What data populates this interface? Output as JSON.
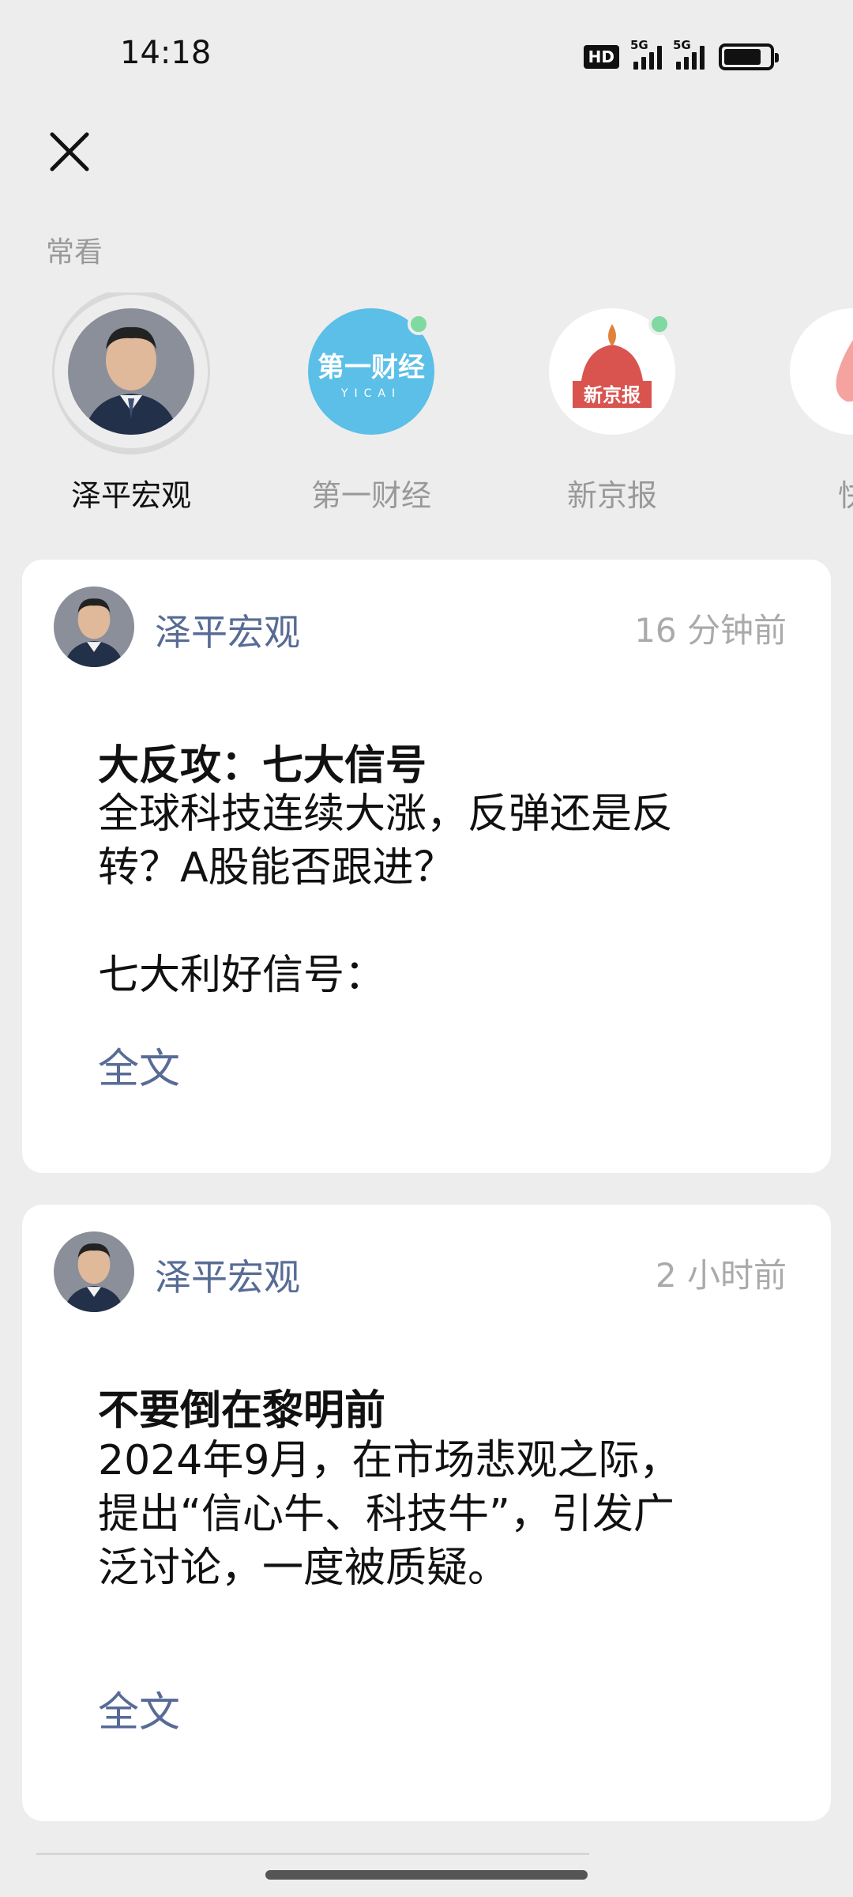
{
  "status_bar": {
    "time": "14:18",
    "hd": "HD",
    "network1": "5G",
    "network2": "5G"
  },
  "header": {
    "section_label": "常看"
  },
  "accounts": [
    {
      "name": "泽平宏观",
      "active": true,
      "icon": "person-avatar"
    },
    {
      "name": "第一财经",
      "active": false,
      "icon": "yicai-logo"
    },
    {
      "name": "新京报",
      "active": false,
      "icon": "xinjingbao-logo"
    },
    {
      "name": "快",
      "active": false,
      "icon": "flame-logo"
    }
  ],
  "logos": {
    "yicai_text": "第一财经",
    "yicai_sub": "YICAI",
    "xjb_text": "新京报"
  },
  "posts": [
    {
      "author": "泽平宏观",
      "time": "16 分钟前",
      "title": "大反攻：七大信号",
      "body_lines": [
        "全球科技连续大涨，反弹还是反",
        "转？A股能否跟进？",
        "",
        "七大利好信号："
      ],
      "more": "全文"
    },
    {
      "author": "泽平宏观",
      "time": "2 小时前",
      "title": "不要倒在黎明前",
      "body_lines": [
        "2024年9月，在市场悲观之际，",
        "提出“信心牛、科技牛”，引发广",
        "泛讨论，一度被质疑。"
      ],
      "more": "全文"
    }
  ],
  "colors": {
    "background": "#ededed",
    "link": "#576b95",
    "unread_dot": "#7fd9a0",
    "yicai_blue": "#5bbfe8",
    "xjb_red": "#d9534f"
  }
}
